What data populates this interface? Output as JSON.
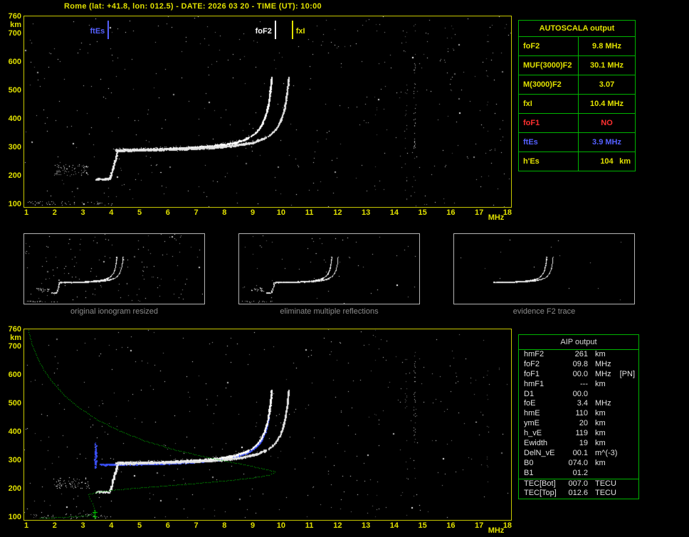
{
  "header": {
    "title": "Rome (lat: +41.8, lon: 012.5) - DATE: 2026 03 20 - TIME (UT): 10:00"
  },
  "top_plot": {
    "y_unit": "km",
    "x_unit": "MHz",
    "y_ticks": [
      760,
      700,
      600,
      500,
      400,
      300,
      200,
      100
    ],
    "x_ticks": [
      1,
      2,
      3,
      4,
      5,
      6,
      7,
      8,
      9,
      10,
      11,
      12,
      13,
      14,
      15,
      16,
      17,
      18
    ],
    "markers": [
      {
        "label": "ftEs",
        "freq_mhz": 3.9,
        "color": "blue",
        "side": "left"
      },
      {
        "label": "foF2",
        "freq_mhz": 9.8,
        "color": "white",
        "side": "left"
      },
      {
        "label": "fxI",
        "freq_mhz": 10.4,
        "color": "yellow",
        "side": "right"
      }
    ]
  },
  "bottom_plot": {
    "y_unit": "km",
    "x_unit": "MHz",
    "y_ticks": [
      760,
      700,
      600,
      500,
      400,
      300,
      200,
      100
    ],
    "x_ticks": [
      1,
      2,
      3,
      4,
      5,
      6,
      7,
      8,
      9,
      10,
      11,
      12,
      13,
      14,
      15,
      16,
      17,
      18
    ]
  },
  "autoscala_table": {
    "title": "AUTOSCALA output",
    "rows": [
      {
        "label": "foF2",
        "value": "9.8 MHz",
        "color": "yellow"
      },
      {
        "label": "MUF(3000)F2",
        "value": "30.1 MHz",
        "color": "yellow"
      },
      {
        "label": "M(3000)F2",
        "value": "3.07",
        "color": "yellow"
      },
      {
        "label": "fxI",
        "value": "10.4 MHz",
        "color": "yellow"
      },
      {
        "label": "foF1",
        "value": "NO",
        "color": "red"
      },
      {
        "label": "ftEs",
        "value": "3.9 MHz",
        "color": "blue"
      },
      {
        "label": "h'Es",
        "value": "104",
        "unit": "km",
        "color": "yellow"
      }
    ]
  },
  "thumbnails": [
    {
      "caption": "original ionogram resized"
    },
    {
      "caption": "eliminate multiple reflections"
    },
    {
      "caption": "evidence F2 trace"
    }
  ],
  "aip_table": {
    "title": "AIP output",
    "rows": [
      {
        "name": "hmF2",
        "value": "261",
        "unit": "km"
      },
      {
        "name": "foF2",
        "value": "09.8",
        "unit": "MHz"
      },
      {
        "name": "foF1",
        "value": "00.0",
        "unit": "MHz",
        "note": "[PN]"
      },
      {
        "name": "hmF1",
        "value": "---",
        "unit": "km"
      },
      {
        "name": "D1",
        "value": "00.0",
        "unit": ""
      },
      {
        "name": "foE",
        "value": "3.4",
        "unit": "MHz"
      },
      {
        "name": "hmE",
        "value": "110",
        "unit": "km"
      },
      {
        "name": "ymE",
        "value": "20",
        "unit": "km"
      },
      {
        "name": "h_vE",
        "value": "119",
        "unit": "km"
      },
      {
        "name": "Ewidth",
        "value": "19",
        "unit": "km"
      },
      {
        "name": "DelN_vE",
        "value": "00.1",
        "unit": "m^(-3)"
      },
      {
        "name": "B0",
        "value": "074.0",
        "unit": "km"
      },
      {
        "name": "B1",
        "value": "01.2",
        "unit": ""
      },
      {
        "name": "TEC[Bot]",
        "value": "007.0",
        "unit": "TECU",
        "separator_above": true
      },
      {
        "name": "TEC[Top]",
        "value": "012.6",
        "unit": "TECU"
      }
    ]
  },
  "ionogram": {
    "x_axis_mhz": {
      "min": 1,
      "max": 18
    },
    "y_axis_km": {
      "min": 100,
      "max": 760
    },
    "foF2_MHz": 9.8,
    "fxI_MHz": 10.4,
    "ftEs_MHz": 3.9,
    "hEs_km": 104,
    "hmF2_km": 261,
    "foE_MHz": 3.4,
    "hmE_km": 110,
    "B0_km": 74
  },
  "colors": {
    "yellow": "#e0e000",
    "green": "#00b400",
    "red": "#ff3030",
    "blue": "#5560ff",
    "white": "#ffffff",
    "trace_white": "#ffffff",
    "profile_green": "#00c800",
    "restored_blue": "#3c52ff",
    "caption_gray": "#8c8c8c"
  }
}
